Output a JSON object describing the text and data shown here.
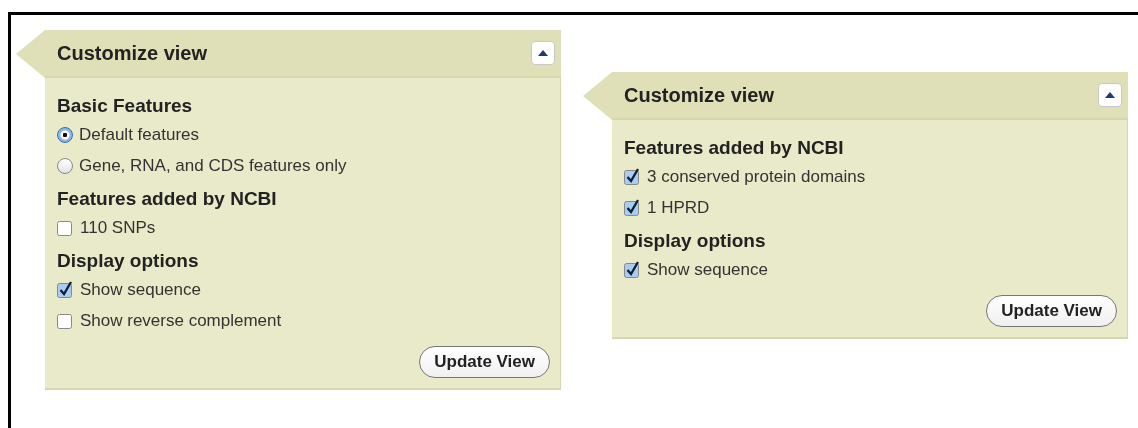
{
  "panels": [
    {
      "title": "Customize view",
      "sections": [
        {
          "heading": "Basic Features",
          "items": [
            {
              "kind": "radio",
              "label": "Default features",
              "selected": true
            },
            {
              "kind": "radio",
              "label": "Gene, RNA, and CDS features only",
              "selected": false
            }
          ]
        },
        {
          "heading": "Features added by NCBI",
          "items": [
            {
              "kind": "checkbox",
              "label": "110 SNPs",
              "checked": false
            }
          ]
        },
        {
          "heading": "Display options",
          "items": [
            {
              "kind": "checkbox",
              "label": "Show sequence",
              "checked": true
            },
            {
              "kind": "checkbox",
              "label": "Show reverse complement",
              "checked": false
            }
          ]
        }
      ],
      "button": "Update View"
    },
    {
      "title": "Customize view",
      "sections": [
        {
          "heading": "Features added by NCBI",
          "items": [
            {
              "kind": "checkbox",
              "label": "3 conserved protein domains",
              "checked": true
            },
            {
              "kind": "checkbox",
              "label": "1 HPRD",
              "checked": true
            }
          ]
        },
        {
          "heading": "Display options",
          "items": [
            {
              "kind": "checkbox",
              "label": "Show sequence",
              "checked": true
            }
          ]
        }
      ],
      "button": "Update View"
    }
  ]
}
